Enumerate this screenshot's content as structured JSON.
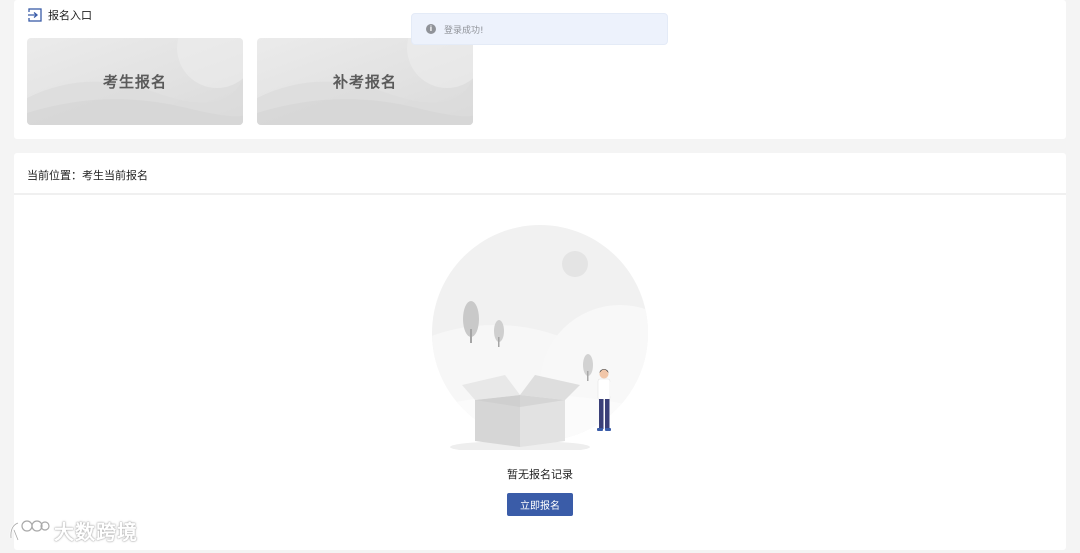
{
  "entry": {
    "title": "报名入口",
    "cards": [
      {
        "label": "考生报名"
      },
      {
        "label": "补考报名"
      }
    ]
  },
  "toast": {
    "message": "登录成功!",
    "icon": "info-icon"
  },
  "main": {
    "breadcrumb": "当前位置：考生当前报名",
    "empty_text": "暂无报名记录",
    "register_button": "立即报名"
  },
  "watermark": {
    "text": "大数跨境"
  },
  "colors": {
    "primary": "#3a5ca8",
    "toast_bg": "#edf2fc",
    "page_bg": "#f4f4f4"
  }
}
